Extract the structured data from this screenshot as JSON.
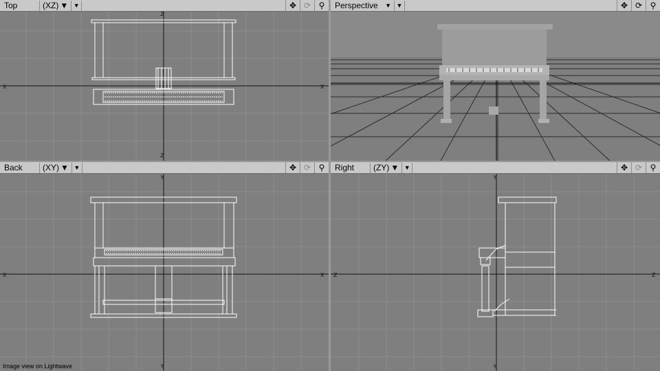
{
  "viewports": {
    "top": {
      "view": "Top",
      "axes": "(XZ)"
    },
    "persp": {
      "view": "Perspective",
      "axes": ""
    },
    "back": {
      "view": "Back",
      "axes": "(XY)"
    },
    "right": {
      "view": "Right",
      "axes": "(ZY)"
    }
  },
  "icons": {
    "view_menu": "chevron-down-icon",
    "move": "move-arrows-icon",
    "rotate": "rotate-icon",
    "zoom": "magnifier-icon"
  },
  "axis_labels": {
    "x": "X",
    "y": "Y",
    "z": "Z"
  },
  "caption": "Image view on Lightwave",
  "colors": {
    "viewport_bg": "#7f7f7f",
    "grid": "#8e8e8e",
    "wireframe": "#ffffff",
    "header_bg": "#c9c9c9"
  }
}
